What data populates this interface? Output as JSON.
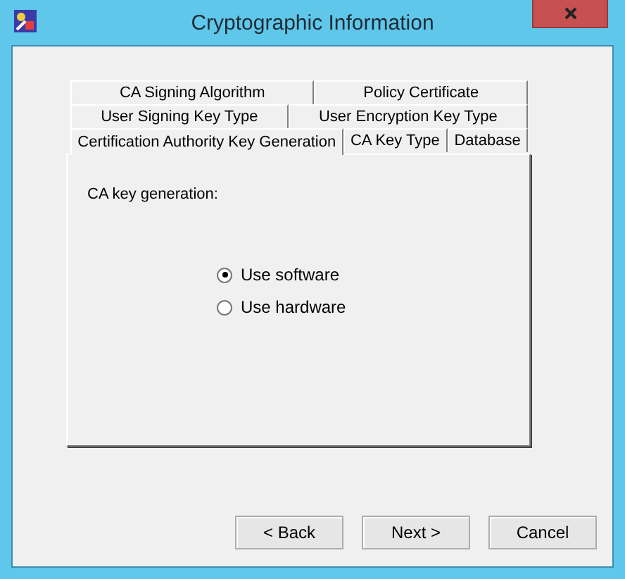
{
  "window": {
    "title": "Cryptographic Information"
  },
  "tab_rows": [
    [
      {
        "label": "CA Signing Algorithm",
        "selected": false
      },
      {
        "label": "Policy Certificate",
        "selected": false
      }
    ],
    [
      {
        "label": "User Signing Key Type",
        "selected": false
      },
      {
        "label": "User Encryption Key Type",
        "selected": false
      }
    ],
    [
      {
        "label": "Certification Authority Key Generation",
        "selected": true
      },
      {
        "label": "CA Key Type",
        "selected": false
      },
      {
        "label": "Database",
        "selected": false
      }
    ]
  ],
  "panel": {
    "label": "CA key generation:",
    "options": [
      {
        "label": "Use software",
        "selected": true
      },
      {
        "label": "Use hardware",
        "selected": false
      }
    ]
  },
  "buttons": [
    "< Back",
    "Next >",
    "Cancel"
  ]
}
